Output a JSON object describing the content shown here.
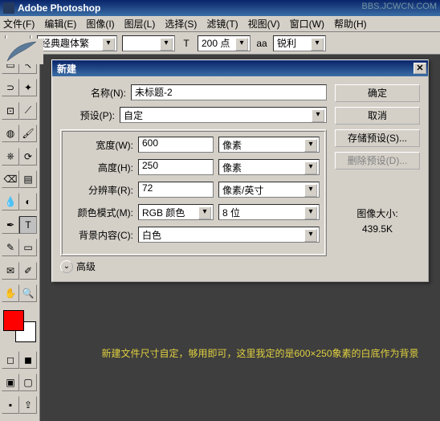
{
  "app": {
    "title": "Adobe Photoshop",
    "watermark": "BBS.JCWCN.COM"
  },
  "menu": {
    "file": "文件(F)",
    "edit": "编辑(E)",
    "image": "图像(I)",
    "layer": "图层(L)",
    "select": "选择(S)",
    "filter": "滤镜(T)",
    "view": "视图(V)",
    "window": "窗口(W)",
    "help": "帮助(H)"
  },
  "optbar": {
    "font": "经典趣体繁",
    "size_icon": "T",
    "size": "200 点",
    "aa_label": "aa",
    "aa_value": "锐利"
  },
  "dialog": {
    "title": "新建",
    "name_label": "名称(N):",
    "name_value": "未标题-2",
    "preset_label": "预设(P):",
    "preset_value": "自定",
    "width_label": "宽度(W):",
    "width_value": "600",
    "width_unit": "像素",
    "height_label": "高度(H):",
    "height_value": "250",
    "height_unit": "像素",
    "res_label": "分辨率(R):",
    "res_value": "72",
    "res_unit": "像素/英寸",
    "mode_label": "颜色模式(M):",
    "mode_value": "RGB 颜色",
    "mode_bits": "8 位",
    "bg_label": "背景内容(C):",
    "bg_value": "白色",
    "advanced": "高级",
    "img_size_label": "图像大小:",
    "img_size_value": "439.5K",
    "btn_ok": "确定",
    "btn_cancel": "取消",
    "btn_save": "存储预设(S)...",
    "btn_del": "删除预设(D)..."
  },
  "caption": "新建文件尺寸自定，够用即可，这里我定的是600×250象素的白底作为背景",
  "tools": {
    "move": "↖",
    "marquee": "▭",
    "lasso": "⊃",
    "wand": "✦",
    "crop": "⊡",
    "slice": "⟋",
    "heal": "◍",
    "brush": "🖌",
    "stamp": "⎈",
    "history": "⟳",
    "eraser": "⌫",
    "grad": "▤",
    "blur": "💧",
    "dodge": "◐",
    "path": "✒",
    "type": "T",
    "pen": "✎",
    "shape": "▭",
    "notes": "✉",
    "eyedrop": "✐",
    "hand": "✋",
    "zoom": "🔍"
  }
}
